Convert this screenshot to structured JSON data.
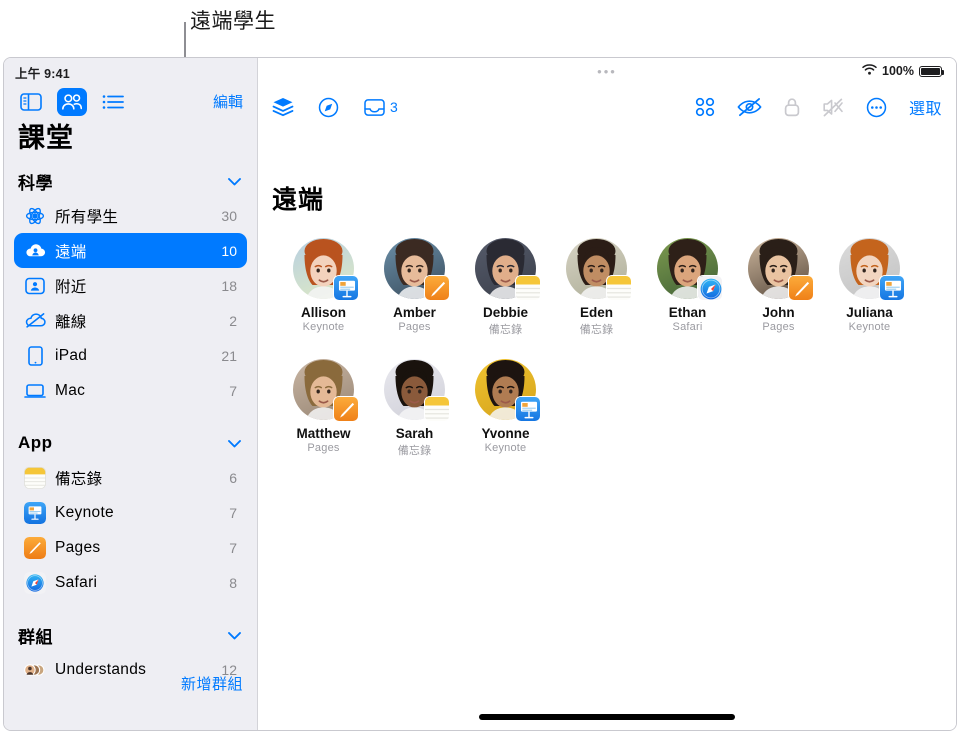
{
  "callout": {
    "label": "遠端學生"
  },
  "status_bar": {
    "time": "上午 9:41",
    "battery_percent": "100%",
    "wifi_icon": "wifi-icon",
    "battery_icon": "battery-icon"
  },
  "sidebar": {
    "title": "課堂",
    "edit_label": "編輯",
    "add_group_label": "新增群組",
    "segmented": [
      {
        "name": "sidebar-toggle",
        "icon": "sidebar-layout-icon",
        "selected": false
      },
      {
        "name": "people-view",
        "icon": "people-icon",
        "selected": true
      },
      {
        "name": "list-view",
        "icon": "list-icon",
        "selected": false
      }
    ],
    "sections": [
      {
        "title": "科學",
        "chevron": "chevron-down-icon",
        "items": [
          {
            "label": "所有學生",
            "count": "30",
            "icon": "atom-icon",
            "selected": false
          },
          {
            "label": "遠端",
            "count": "10",
            "icon": "cloud-person-icon",
            "selected": true
          },
          {
            "label": "附近",
            "count": "18",
            "icon": "person-rect-icon",
            "selected": false
          },
          {
            "label": "離線",
            "count": "2",
            "icon": "cloud-slash-icon",
            "selected": false
          },
          {
            "label": "iPad",
            "count": "21",
            "icon": "ipad-icon",
            "selected": false
          },
          {
            "label": "Mac",
            "count": "7",
            "icon": "mac-icon",
            "selected": false
          }
        ]
      },
      {
        "title": "App",
        "chevron": "chevron-down-icon",
        "items": [
          {
            "label": "備忘錄",
            "count": "6",
            "icon": "notes-app-icon",
            "selected": false
          },
          {
            "label": "Keynote",
            "count": "7",
            "icon": "keynote-app-icon",
            "selected": false
          },
          {
            "label": "Pages",
            "count": "7",
            "icon": "pages-app-icon",
            "selected": false
          },
          {
            "label": "Safari",
            "count": "8",
            "icon": "safari-app-icon",
            "selected": false
          }
        ]
      },
      {
        "title": "群組",
        "chevron": "chevron-down-icon",
        "items": [
          {
            "label": "Understands",
            "count": "12",
            "icon": "group-avatars-icon",
            "selected": false
          }
        ]
      }
    ]
  },
  "main": {
    "title": "遠端",
    "grabber": "•••",
    "select_label": "選取",
    "toolbar_left": [
      {
        "name": "layers-button",
        "icon": "layers-icon",
        "count": ""
      },
      {
        "name": "navigate-button",
        "icon": "compass-icon",
        "count": ""
      },
      {
        "name": "inbox-button",
        "icon": "inbox-tray-icon",
        "count": "3"
      }
    ],
    "toolbar_right": [
      {
        "name": "grid-view-button",
        "icon": "grid-four-icon",
        "enabled": true
      },
      {
        "name": "hide-screen-button",
        "icon": "eye-slash-icon",
        "enabled": true
      },
      {
        "name": "lock-button",
        "icon": "lock-icon",
        "enabled": false
      },
      {
        "name": "mute-button",
        "icon": "speaker-slash-icon",
        "enabled": false
      },
      {
        "name": "more-button",
        "icon": "ellipsis-circle-icon",
        "enabled": true
      }
    ],
    "students": [
      {
        "name": "Allison",
        "app": "Keynote",
        "badge": "keynote-app-icon",
        "skin": "#f3d2bd",
        "hair": "#b9531f",
        "bg1": "#b7cfe2",
        "bg2": "#d9e6c8"
      },
      {
        "name": "Amber",
        "app": "Pages",
        "badge": "pages-app-icon",
        "skin": "#e7bb9a",
        "hair": "#3b2a22",
        "bg1": "#6b8fa8",
        "bg2": "#42586a"
      },
      {
        "name": "Debbie",
        "app": "備忘錄",
        "badge": "notes-app-icon",
        "skin": "#e0ae8a",
        "hair": "#2a2a33",
        "bg1": "#565b6b",
        "bg2": "#3f4450"
      },
      {
        "name": "Eden",
        "app": "備忘錄",
        "badge": "notes-app-icon",
        "skin": "#c08d63",
        "hair": "#2b1d16",
        "bg1": "#d7d3c4",
        "bg2": "#b4b49f"
      },
      {
        "name": "Ethan",
        "app": "Safari",
        "badge": "safari-app-icon",
        "skin": "#dba57c",
        "hair": "#2e2018",
        "bg1": "#7e9b4f",
        "bg2": "#4a6a3a"
      },
      {
        "name": "John",
        "app": "Pages",
        "badge": "pages-app-icon",
        "skin": "#e9c3a1",
        "hair": "#2a1f18",
        "bg1": "#cdb79e",
        "bg2": "#6b5b4c"
      },
      {
        "name": "Juliana",
        "app": "Keynote",
        "badge": "keynote-app-icon",
        "skin": "#f2d5c0",
        "hair": "#c4641d",
        "bg1": "#dcdcdc",
        "bg2": "#c6c6c6"
      },
      {
        "name": "Matthew",
        "app": "Pages",
        "badge": "pages-app-icon",
        "skin": "#e4b996",
        "hair": "#8a6a3c",
        "bg1": "#c9b6a4",
        "bg2": "#a08e7c"
      },
      {
        "name": "Sarah",
        "app": "備忘錄",
        "badge": "notes-app-icon",
        "skin": "#8a5a3b",
        "hair": "#19120d",
        "bg1": "#e9e9ef",
        "bg2": "#d4d4dc"
      },
      {
        "name": "Yvonne",
        "app": "Keynote",
        "badge": "keynote-app-icon",
        "skin": "#b07c52",
        "hair": "#1d1410",
        "bg1": "#f0c431",
        "bg2": "#d9a81e"
      }
    ]
  },
  "colors": {
    "accent": "#007aff",
    "sidebar_bg": "#eeeef3",
    "notes_yellow": "#f5c638",
    "pages_orange": "#f08b21",
    "keynote_blue": "#1b8cf5"
  }
}
